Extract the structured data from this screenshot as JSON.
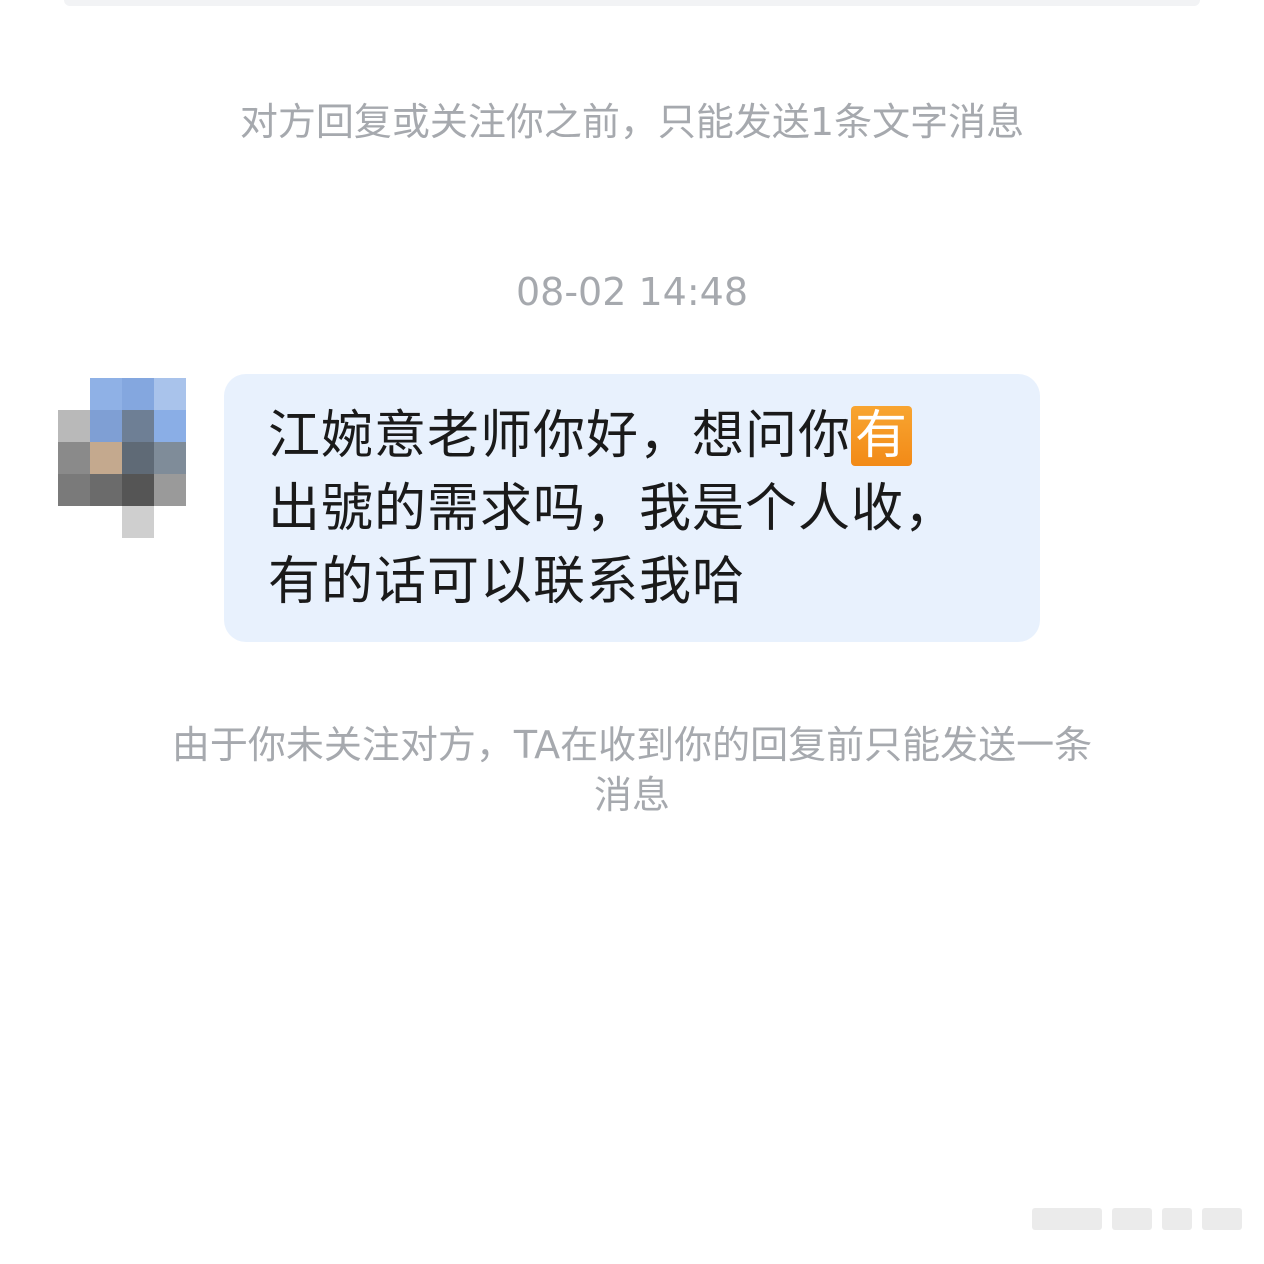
{
  "system_notice_top": "对方回复或关注你之前，只能发送1条文字消息",
  "timestamp": "08-02 14:48",
  "message": {
    "lines": [
      "江婉意老师你好，想问你",
      "出號的需求吗，我是个人收，",
      "有的话可以联系我哈"
    ],
    "highlighted_char": "有"
  },
  "system_notice_bottom_line1": "由于你未关注对方，TA在收到你的回复前只能发送一条",
  "system_notice_bottom_line2": "消息",
  "colors": {
    "bubble_background": "#e8f1fd",
    "notice_text": "#a6a9ae",
    "highlight": "#f28a17"
  }
}
